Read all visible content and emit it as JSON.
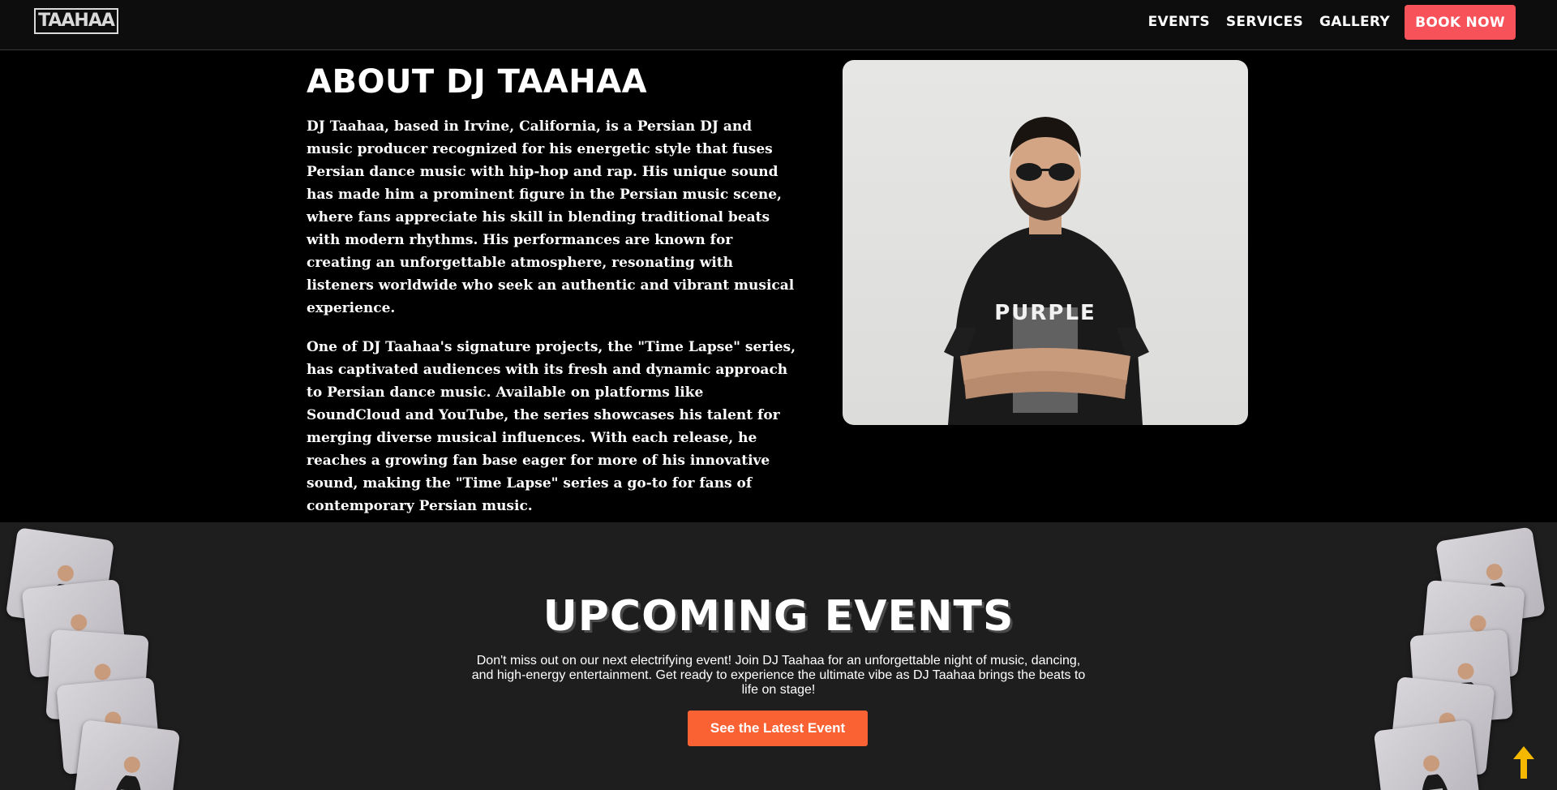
{
  "header": {
    "logo_text": "TAAHAA",
    "nav": [
      {
        "label": "EVENTS"
      },
      {
        "label": "SERVICES"
      },
      {
        "label": "GALLERY"
      }
    ],
    "book_label": "BOOK NOW",
    "book_color": "#f7525a"
  },
  "about": {
    "title": "ABOUT DJ TAAHAA",
    "paragraphs": [
      "DJ Taahaa, based in Irvine, California, is a Persian DJ and music producer recognized for his energetic style that fuses Persian dance music with hip-hop and rap. His unique sound has made him a prominent figure in the Persian music scene, where fans appreciate his skill in blending traditional beats with modern rhythms. His performances are known for creating an unforgettable atmosphere, resonating with listeners worldwide who seek an authentic and vibrant musical experience.",
      "One of DJ Taahaa's signature projects, the \"Time Lapse\" series, has captivated audiences with its fresh and dynamic approach to Persian dance music. Available on platforms like SoundCloud and YouTube, the series showcases his talent for merging diverse musical influences. With each release, he reaches a growing fan base eager for more of his innovative sound, making the \"Time Lapse\" series a go-to for fans of contemporary Persian music."
    ],
    "shirt_text": "PURPLE"
  },
  "events": {
    "title": "UPCOMING EVENTS",
    "description": "Don't miss out on our next electrifying event! Join DJ Taahaa for an unforgettable night of music, dancing, and high-energy entertainment. Get ready to experience the ultimate vibe as DJ Taahaa brings the beats to life on stage!",
    "button_label": "See the Latest Event",
    "button_color": "#fb6233"
  },
  "scroll_top_icon": "arrow-up-icon"
}
